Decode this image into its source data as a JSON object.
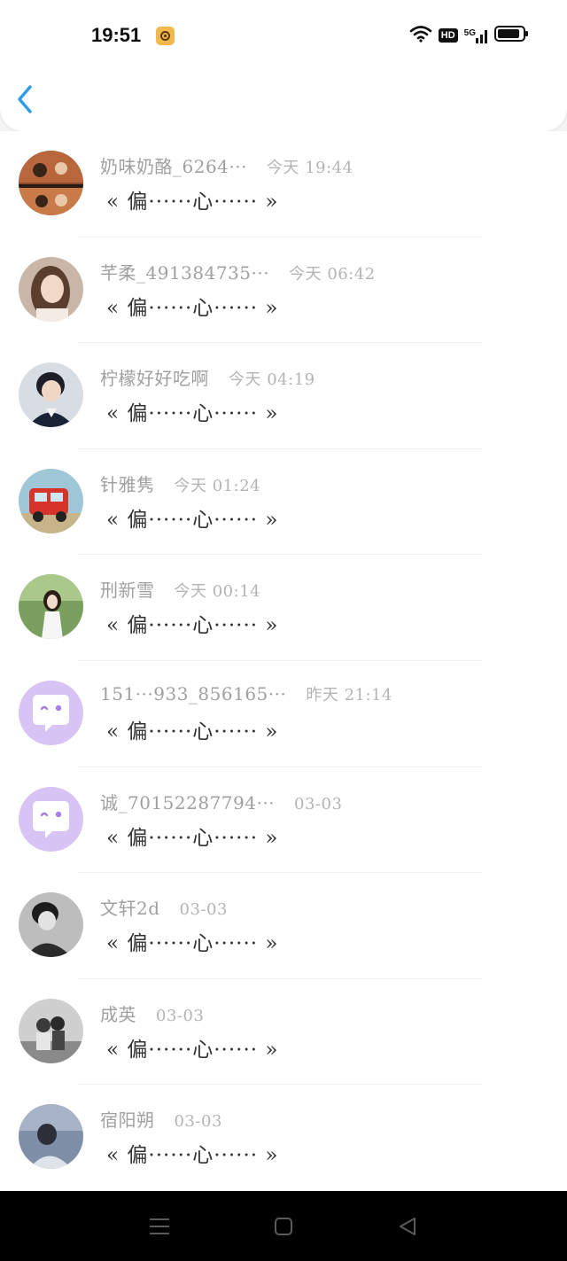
{
  "status_bar": {
    "time": "19:51",
    "hd_label": "HD",
    "network_label": "5G"
  },
  "contacts": [
    {
      "name": "奶味奶酪_6264···",
      "time": "今天 19:44",
      "message": "« 偏······心······ »",
      "avatar": "anime-couple-avatar"
    },
    {
      "name": "芊柔_491384735···",
      "time": "今天 06:42",
      "message": "« 偏······心······ »",
      "avatar": "girl-photo-avatar"
    },
    {
      "name": "柠檬好好吃啊",
      "time": "今天 04:19",
      "message": "« 偏······心······ »",
      "avatar": "boy-photo-avatar"
    },
    {
      "name": "针雅隽",
      "time": "今天 01:24",
      "message": "« 偏······心······ »",
      "avatar": "fire-truck-avatar"
    },
    {
      "name": "刑新雪",
      "time": "今天 00:14",
      "message": "« 偏······心······ »",
      "avatar": "girl-garden-avatar"
    },
    {
      "name": "151···933_856165···",
      "time": "昨天 21:14",
      "message": "« 偏······心······ »",
      "avatar": "default-chat-avatar"
    },
    {
      "name": "诚_70152287794···",
      "time": "03-03",
      "message": "« 偏······心······ »",
      "avatar": "default-chat-avatar"
    },
    {
      "name": "文轩2d",
      "time": "03-03",
      "message": "« 偏······心······ »",
      "avatar": "bw-boy-avatar"
    },
    {
      "name": "成英",
      "time": "03-03",
      "message": "« 偏······心······ »",
      "avatar": "bw-couple-avatar"
    },
    {
      "name": "宿阳朔",
      "time": "03-03",
      "message": "« 偏······心······ »",
      "avatar": "blue-person-avatar"
    }
  ],
  "colors": {
    "accent": "#2c9be8",
    "default_avatar_bg": "#d8c4f4",
    "default_avatar_icon": "#a77de6"
  }
}
